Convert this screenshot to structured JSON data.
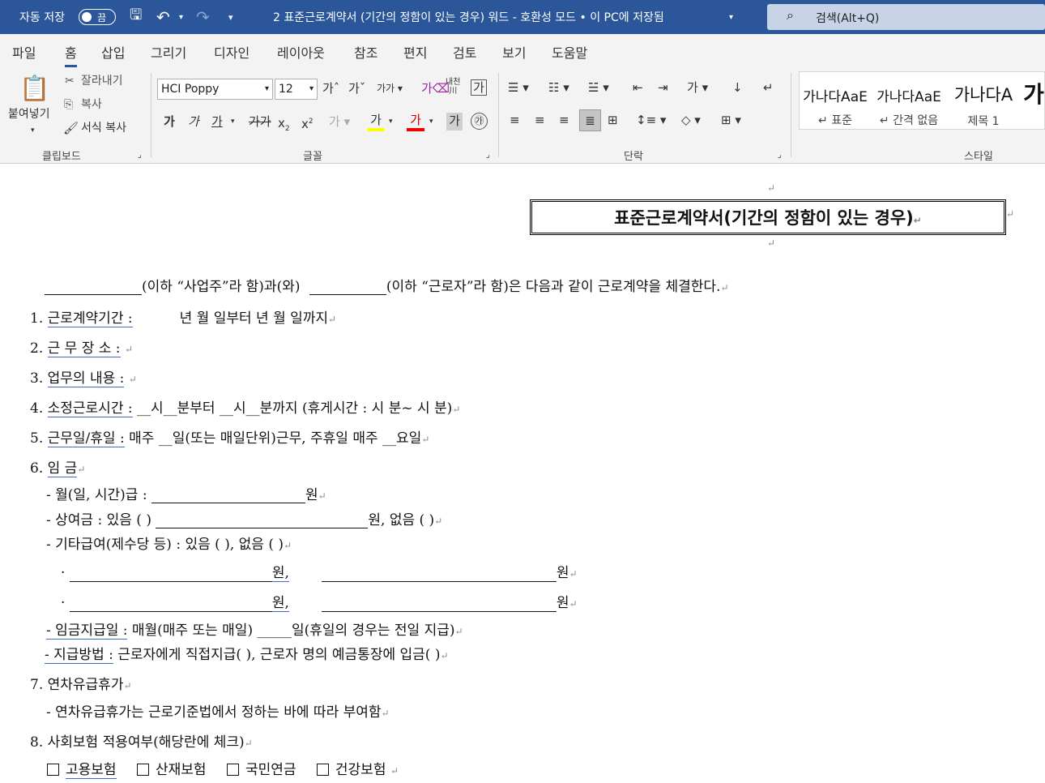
{
  "titlebar": {
    "autosave_label": "자동 저장",
    "autosave_state": "끔",
    "doc_title": "2 표준근로계약서 (기간의 정함이 있는 경우) 워드  -  호환성 모드 • 이 PC에 저장됨",
    "search_placeholder": "검색(Alt+Q)"
  },
  "menu_tabs": [
    "파일",
    "홈",
    "삽입",
    "그리기",
    "디자인",
    "레이아웃",
    "참조",
    "편지",
    "검토",
    "보기",
    "도움말"
  ],
  "ribbon": {
    "clipboard": {
      "paste": "붙여넣기",
      "cut": "잘라내기",
      "copy": "복사",
      "format_painter": "서식 복사",
      "group": "클립보드"
    },
    "font": {
      "name": "HCI Poppy",
      "size": "12",
      "group": "글꼴",
      "bold": "가",
      "italic": "가",
      "underline": "가",
      "highlight": "가"
    },
    "paragraph": {
      "group": "단락"
    },
    "styles": {
      "group": "스타일",
      "items": [
        {
          "preview": "가나다AaE",
          "name": "↵ 표준"
        },
        {
          "preview": "가나다AaE",
          "name": "↵ 간격 없음"
        },
        {
          "preview": "가나다A",
          "name": "제목 1"
        },
        {
          "preview": "가",
          "name": ""
        }
      ]
    }
  },
  "document": {
    "title": "표준근로계약서(기간의 정함이 있는 경우)",
    "intro_a": "(이하 “사업주”라 함)과(와)",
    "intro_b": "(이하 “근로자”라 함)은 다음과 같이 근로계약을 체결한다.",
    "s1_label": "근로계약기간 :",
    "s1_rest": "년    월    일부터        년    월    일까지",
    "s2_label": "근 무 장 소 :",
    "s3_label": "업무의 내용 :",
    "s4_label": "소정근로시간 :",
    "s4_rest": "__시__분부터 __시__분까지 (휴게시간 :  시  분~  시   분)",
    "s5_label": "근무일/휴일 :",
    "s5_rest": "매주 __일(또는 매일단위)근무, 주휴일 매주 __요일",
    "s6_label": "임    금",
    "w1": "- 월(일, 시간)급 :",
    "w1_end": "원",
    "w2": "- 상여금 :",
    "w2_mid": "있음 (       )",
    "w2_end": "원,   없음 (         )",
    "w3": "- 기타급여(제수당 등) :",
    "w3_rest": "있음 (      ),     없음 (       )",
    "w_won_comma": "원,",
    "w_won": "원",
    "w4": "- 임금지급일 :",
    "w4_rest": "매월(매주 또는 매일)   _____일(휴일의 경우는 전일 지급)",
    "w5": "- 지급방법 :",
    "w5_rest": "근로자에게 직접지급(      ),  근로자 명의 예금통장에 입금(      )",
    "s7_label": "연차유급휴가",
    "s7_line": "- 연차유급휴가는 근로기준법에서 정하는 바에 따라 부여함",
    "s8_label": "사회보험 적용여부(해당란에 체크)",
    "insurances": [
      "고용보험",
      "산재보험",
      "국민연금",
      "건강보험"
    ]
  }
}
